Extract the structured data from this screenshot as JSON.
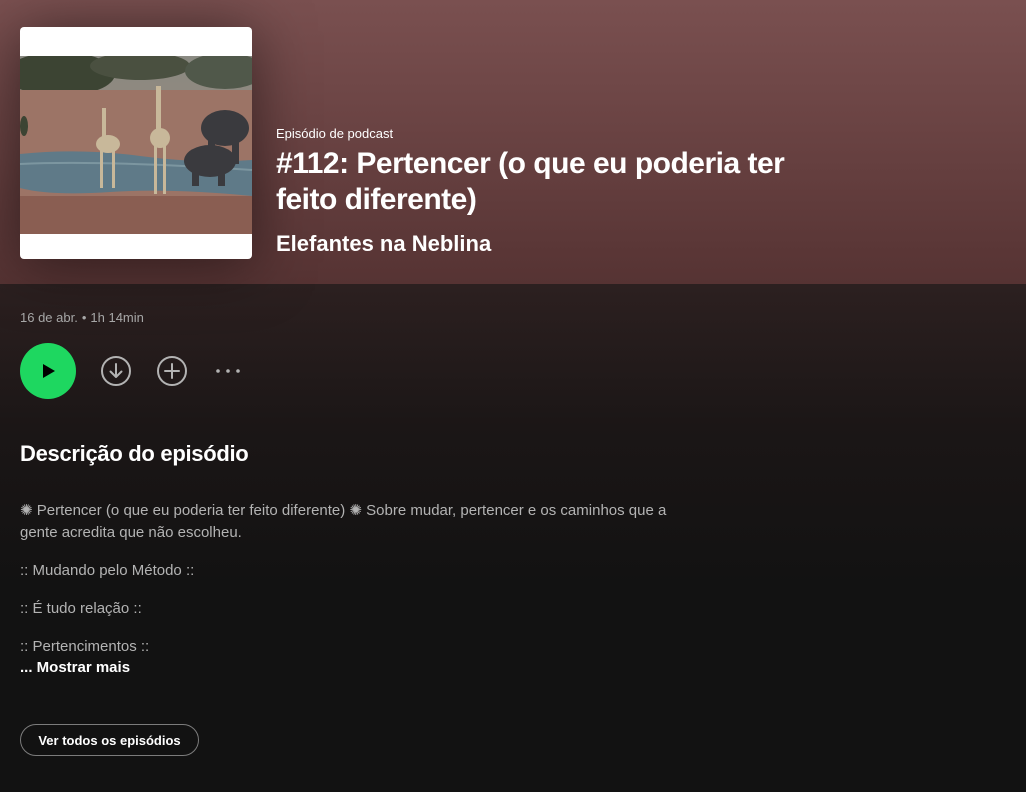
{
  "episode": {
    "type_label": "Episódio de podcast",
    "title": "#112: Pertencer (o que eu poderia ter feito diferente)",
    "show_name": "Elefantes na Neblina",
    "date": "16 de abr.",
    "separator": "•",
    "duration": "1h 14min"
  },
  "actions": {
    "play": "play-icon",
    "download": "download-icon",
    "add": "add-icon",
    "more": "more-options-icon",
    "accent_color": "#1ed760"
  },
  "description": {
    "heading": "Descrição do episódio",
    "paragraphs": [
      "✺ Pertencer (o que eu poderia ter feito diferente) ✺ Sobre mudar, pertencer e os caminhos que a gente acredita que não escolheu.",
      ":: Mudando pelo Método ::",
      ":: É tudo relação ::",
      ":: Pertencimentos ::"
    ],
    "show_more": "... Mostrar mais"
  },
  "footer": {
    "all_episodes_button": "Ver todos os episódios"
  }
}
